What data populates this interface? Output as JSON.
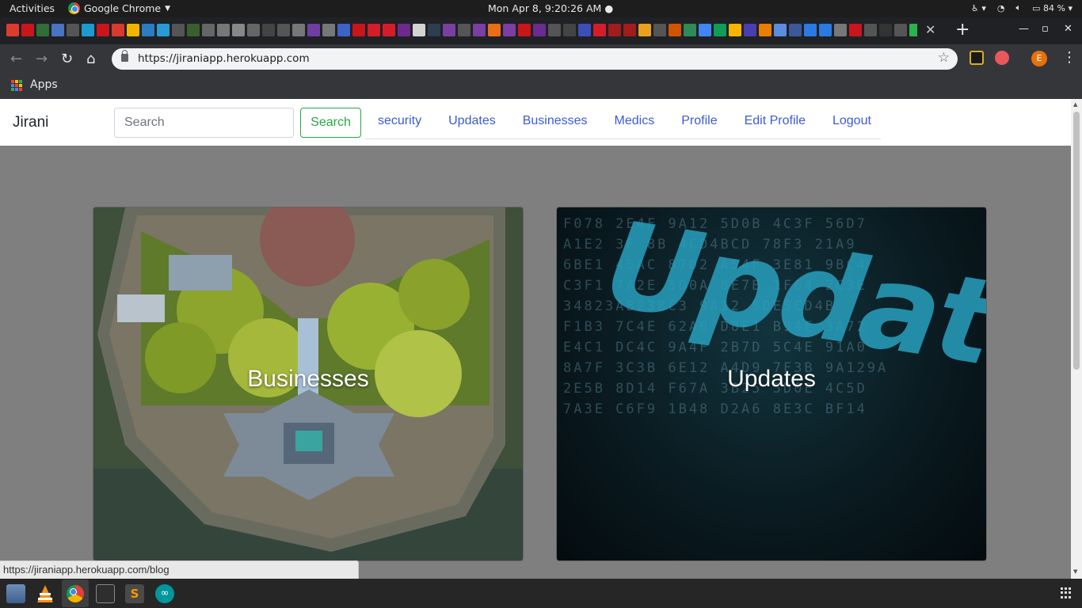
{
  "system_bar": {
    "activities": "Activities",
    "app_name": "Google Chrome",
    "clock": "Mon Apr  8,  9:20:26 AM",
    "battery": "84 %"
  },
  "browser": {
    "url": "https://jiraniapp.herokuapp.com",
    "avatar_letter": "E",
    "bookmarks_apps": "Apps",
    "status_url": "https://jiraniapp.herokuapp.com/blog"
  },
  "page": {
    "brand": "Jirani",
    "search": {
      "placeholder": "Search",
      "button": "Search"
    },
    "nav": [
      "security",
      "Updates",
      "Businesses",
      "Medics",
      "Profile",
      "Edit Profile",
      "Logout"
    ],
    "cards": [
      {
        "title": "Businesses"
      },
      {
        "title": "Updates"
      }
    ]
  },
  "colors": {
    "page_bg": "#7f7f7f",
    "link": "#3c5bd6",
    "success": "#28a745",
    "chrome_dark": "#35363a"
  },
  "icons": {
    "dock": [
      "files-icon",
      "vlc-icon",
      "chrome-icon",
      "terminal-icon",
      "sublime-text-icon",
      "arduino-icon"
    ]
  }
}
